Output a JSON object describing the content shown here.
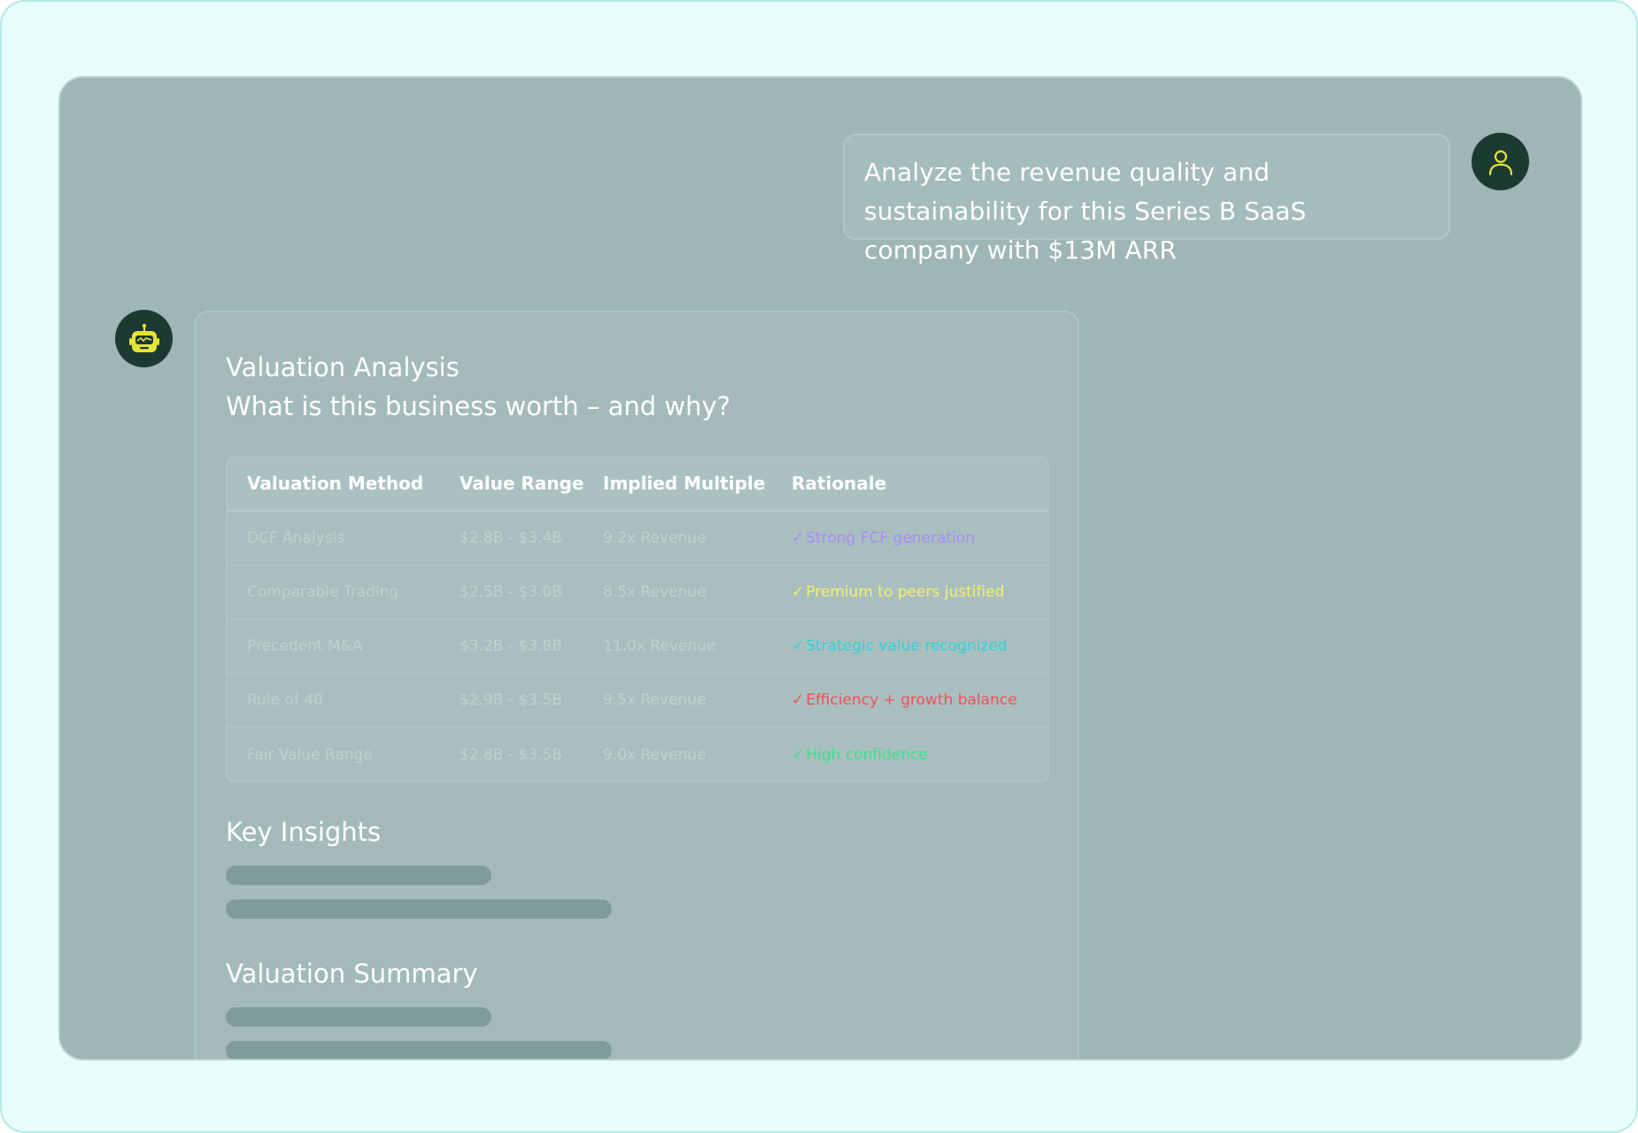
{
  "user_message": {
    "text": "Analyze the revenue quality and sustainability for this Series B SaaS company with $13M ARR",
    "avatar_icon": "user-icon"
  },
  "assistant": {
    "avatar_icon": "robot-icon",
    "title": "Valuation Analysis",
    "subtitle": "What is this business worth – and why?",
    "table": {
      "headers": [
        "Valuation Method",
        "Value Range",
        "Implied Multiple",
        "Rationale"
      ],
      "rows": [
        {
          "method": "DCF Analysis",
          "range": "$2.8B - $3.4B",
          "multiple": "9.2x Revenue",
          "check": "✓",
          "rationale": "Strong FCF generation",
          "color": "#a78bfa"
        },
        {
          "method": "Comparable Trading",
          "range": "$2.5B - $3.0B",
          "multiple": "8.5x Revenue",
          "check": "✓",
          "rationale": "Premium to peers justified",
          "color": "#f5f06a"
        },
        {
          "method": "Precedent M&A",
          "range": "$3.2B - $3.8B",
          "multiple": "11.0x Revenue",
          "check": "✓",
          "rationale": "Strategic value recognized",
          "color": "#2ed3d8"
        },
        {
          "method": "Rule of 40",
          "range": "$2.9B - $3.5B",
          "multiple": "9.5x Revenue",
          "check": "✓",
          "rationale": "Efficiency + growth balance",
          "color": "#f0505a"
        },
        {
          "method": "Fair Value Range",
          "range": "$2.8B - $3.5B",
          "multiple": "9.0x Revenue",
          "check": "✓",
          "rationale": "High confidence",
          "color": "#3ee08a"
        }
      ]
    },
    "key_insights_heading": "Key Insights",
    "valuation_summary_heading": "Valuation Summary"
  },
  "colors": {
    "avatar_bg": "#1c3a31",
    "avatar_icon": "#e6e23a",
    "panel_bg": "#9eb6b6",
    "frame_bg": "#e8fcfb"
  }
}
